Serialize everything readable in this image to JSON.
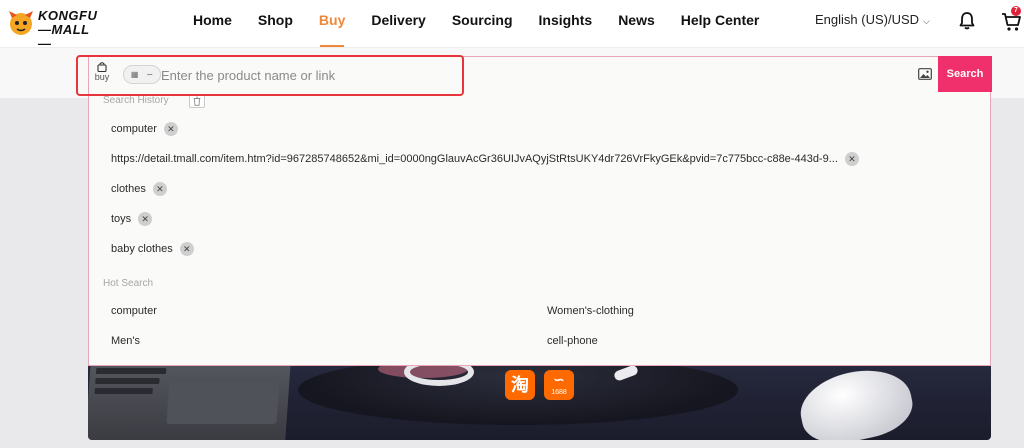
{
  "header": {
    "logo": {
      "line1": "KONGFU",
      "line2": "MALL"
    },
    "nav": [
      "Home",
      "Shop",
      "Buy",
      "Delivery",
      "Sourcing",
      "Insights",
      "News",
      "Help Center"
    ],
    "active_nav": "Buy",
    "language": "English (US)/USD",
    "cart_count": "7"
  },
  "search": {
    "mode_label": "buy",
    "placeholder": "Enter the product name or link",
    "value": "",
    "button_label": "Search"
  },
  "history": {
    "title": "Search History",
    "items": [
      "computer",
      "https://detail.tmall.com/item.htm?id=967285748652&mi_id=0000ngGlauvAcGr36UIJvAQyjStRtsUKY4dr726VrFkyGEk&pvid=7c775bcc-c88e-443d-9...",
      "clothes",
      "toys",
      "baby clothes"
    ]
  },
  "hot": {
    "title": "Hot Search",
    "items": [
      "computer",
      "Women's-clothing",
      "Men's",
      "cell-phone"
    ]
  },
  "sources": {
    "taobao": "淘",
    "alibaba_1688": "1688"
  },
  "colors": {
    "accent": "#f0883a",
    "search_button": "#f0306c",
    "highlight": "#e6353b"
  }
}
